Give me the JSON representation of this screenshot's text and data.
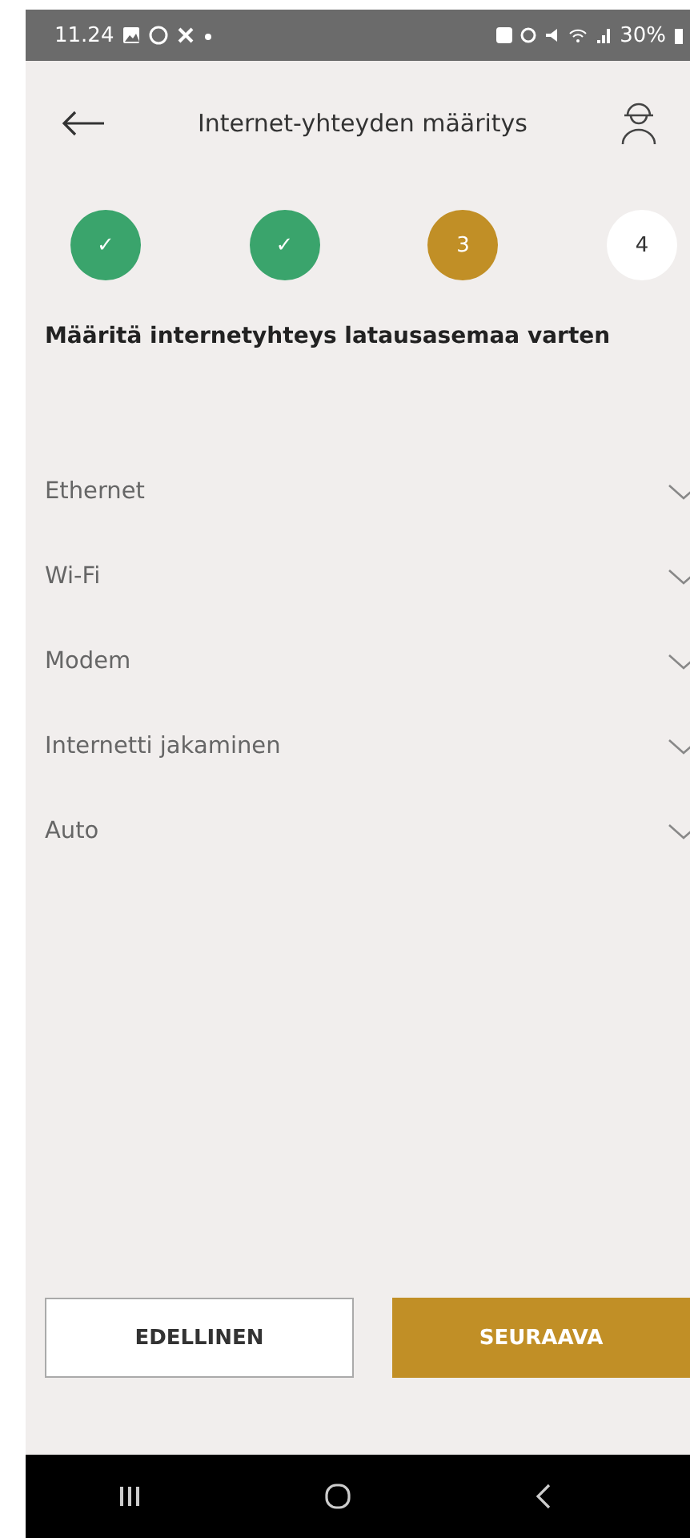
{
  "status_bar": {
    "time": "11.24",
    "battery": "30%"
  },
  "header": {
    "title": "Internet-yhteyden määritys"
  },
  "steps": [
    {
      "label": "✓",
      "done": true,
      "selected": false
    },
    {
      "label": "✓",
      "done": true,
      "selected": false
    },
    {
      "label": "3",
      "done": false,
      "selected": true
    },
    {
      "label": "4",
      "done": false,
      "selected": false
    }
  ],
  "heading": "Määritä internetyhteys latausasemaa varten",
  "options": [
    {
      "label": "Ethernet",
      "expanded": false
    },
    {
      "label": "Wi-Fi",
      "expanded": false
    },
    {
      "label": "Modem",
      "expanded": false
    },
    {
      "label": "Internetti jakaminen",
      "expanded": false
    },
    {
      "label": "Auto",
      "expanded": false
    }
  ],
  "buttons": [
    {
      "label": "EDELLINEN",
      "kind": "secondary"
    },
    {
      "label": "SEURAAVA",
      "kind": "primary"
    }
  ]
}
